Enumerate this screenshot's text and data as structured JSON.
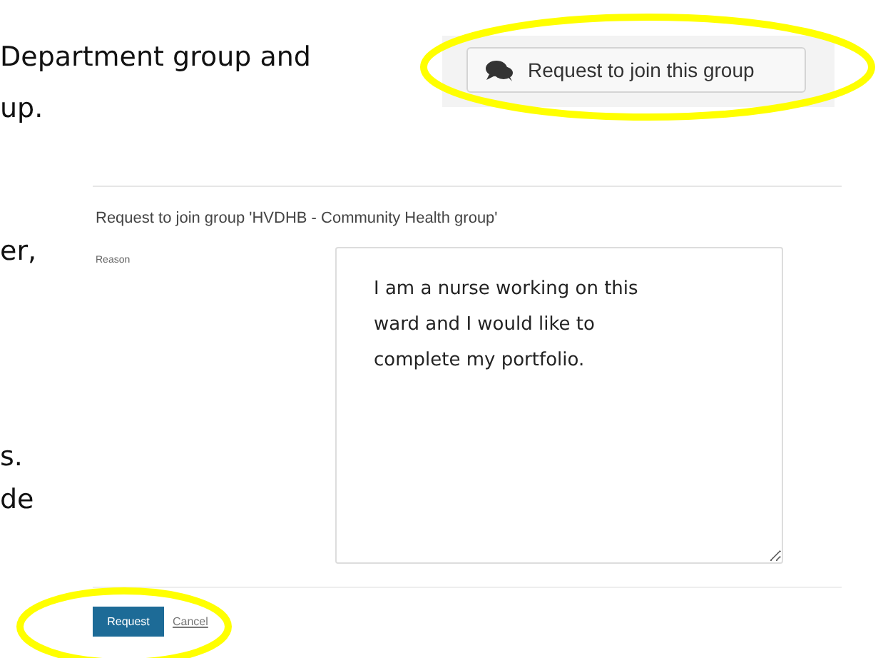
{
  "document_text_top": [
    "Department group and",
    "up."
  ],
  "document_text_side": [
    "er,",
    "s.",
    "de"
  ],
  "join_button": {
    "label": "Request to join this group"
  },
  "form": {
    "title": "Request to join group 'HVDHB - Community Health group'",
    "reason_label": "Reason",
    "reason_value": "I am a nurse working on this ward and I would like to complete my portfolio.",
    "submit": "Request",
    "cancel": "Cancel"
  }
}
